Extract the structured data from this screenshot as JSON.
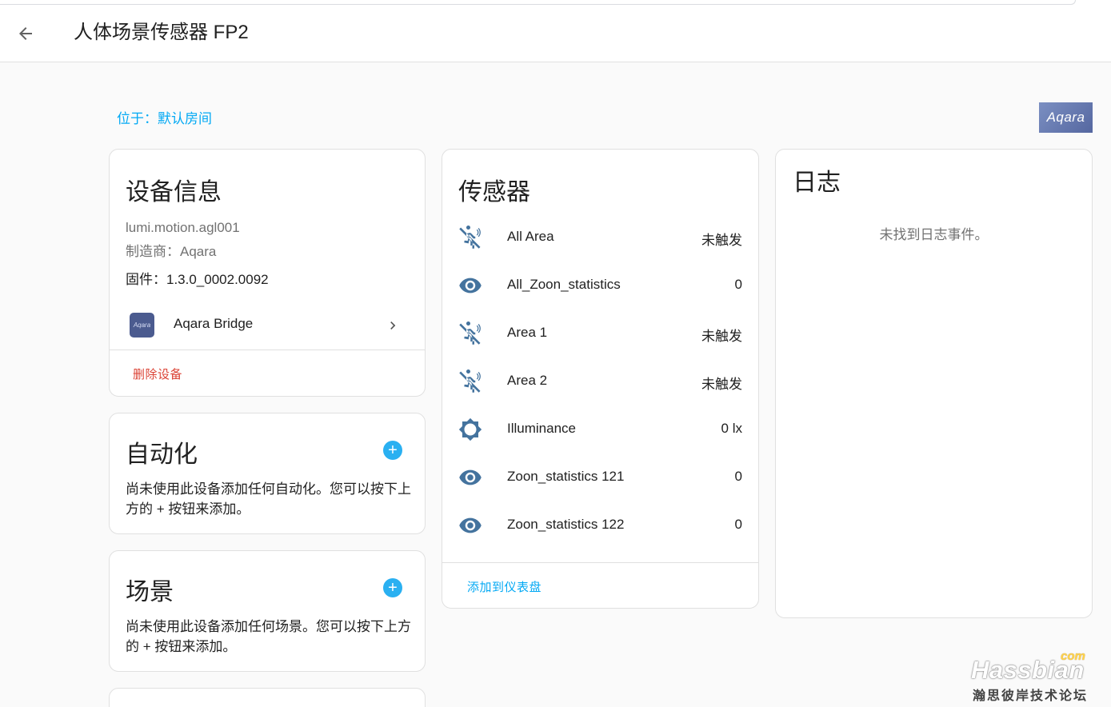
{
  "header": {
    "title": "人体场景传感器 FP2"
  },
  "location_text": "位于：默认房间",
  "brand_logo_text": "Aqara",
  "device_info": {
    "title": "设备信息",
    "model": "lumi.motion.agl001",
    "manufacturer": "制造商：Aqara",
    "firmware": "固件：1.3.0_0002.0092",
    "bridge_icon_text": "Aqara",
    "bridge_label": "Aqara Bridge",
    "delete_label": "删除设备"
  },
  "automation": {
    "title": "自动化",
    "description": "尚未使用此设备添加任何自动化。您可以按下上方的 + 按钮来添加。"
  },
  "scene": {
    "title": "场景",
    "description": "尚未使用此设备添加任何场景。您可以按下上方的 + 按钮来添加。"
  },
  "sensors": {
    "title": "传感器",
    "items": [
      {
        "icon": "motion-sensor-icon",
        "name": "All Area",
        "state": "未触发"
      },
      {
        "icon": "eye-icon",
        "name": "All_Zoon_statistics",
        "state": "0"
      },
      {
        "icon": "motion-sensor-icon",
        "name": "Area 1",
        "state": "未触发"
      },
      {
        "icon": "motion-sensor-icon",
        "name": "Area 2",
        "state": "未触发"
      },
      {
        "icon": "brightness-icon",
        "name": "Illuminance",
        "state": "0 lx"
      },
      {
        "icon": "eye-icon",
        "name": "Zoon_statistics 121",
        "state": "0"
      },
      {
        "icon": "eye-icon",
        "name": "Zoon_statistics 122",
        "state": "0"
      }
    ],
    "add_to_dashboard": "添加到仪表盘"
  },
  "logbook": {
    "title": "日志",
    "empty_text": "未找到日志事件。"
  },
  "watermark": {
    "main": "Hassbian",
    "com": "com",
    "sub": "瀚思彼岸技术论坛"
  },
  "colors": {
    "accent": "#03a9f4",
    "icon": "#44739e",
    "delete": "#db4437"
  }
}
